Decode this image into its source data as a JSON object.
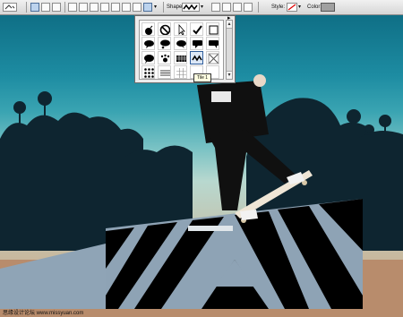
{
  "options_bar": {
    "shape_label": "Shape:",
    "style_label": "Style:",
    "color_label": "Color:",
    "color_value": "#a0a0a0",
    "selected_shape_icon": "zigzag-shape-icon",
    "style_icon": "no-style-slash-icon"
  },
  "shape_picker": {
    "tooltip": "Tile 1",
    "selected": "Tile 1",
    "shapes": [
      "bomb-icon",
      "no-sign-icon",
      "cursor-icon",
      "checkmark-icon",
      "blank-square-icon",
      "speech-bubble-icon",
      "thought-bubble-icon",
      "speech-bubble-icon",
      "rect-bubble-icon",
      "rect-bubble-icon",
      "round-bubble-icon",
      "paw-icon",
      "dense-grid-icon",
      "zigzag-tile-icon",
      "texture-tile-icon",
      "dots-tile-icon",
      "text-tile-icon",
      "grid-tile-icon",
      "",
      ""
    ]
  },
  "watermark": "思缘设计论坛 www.missyuan.com"
}
